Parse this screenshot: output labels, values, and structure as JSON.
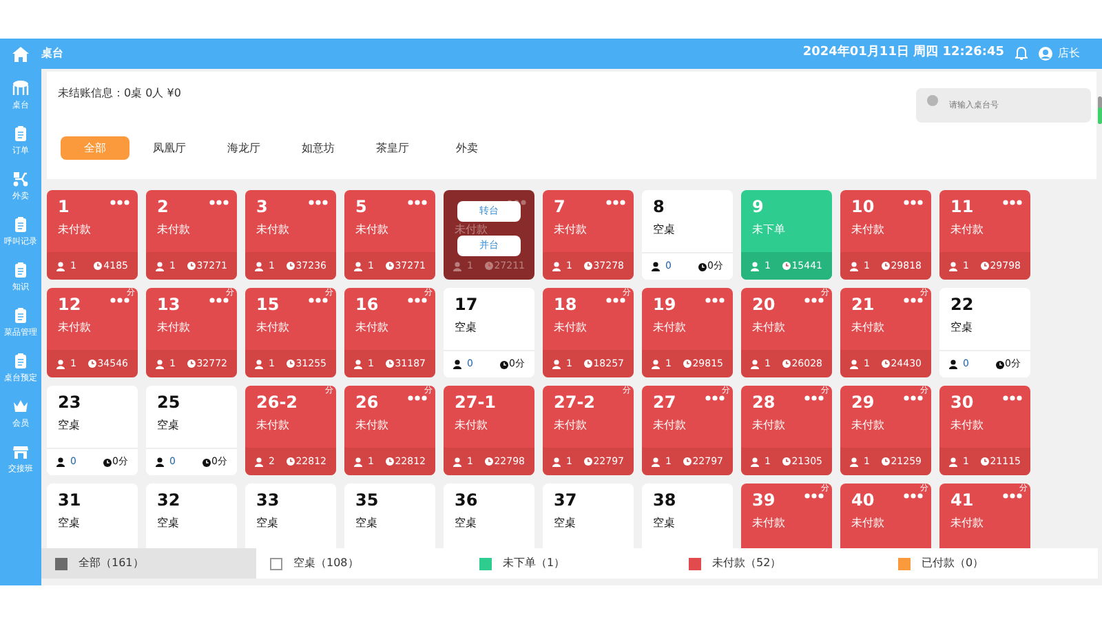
{
  "header": {
    "title": "桌台",
    "datetime": "2024年01月11日 周四 12:26:45",
    "user": "店长"
  },
  "sidebar": {
    "items": [
      {
        "label": "桌台"
      },
      {
        "label": "订单"
      },
      {
        "label": "外卖"
      },
      {
        "label": "呼叫记录"
      },
      {
        "label": "知识"
      },
      {
        "label": "菜品管理"
      },
      {
        "label": "桌台预定"
      },
      {
        "label": "会员"
      },
      {
        "label": "交接班"
      }
    ]
  },
  "summary": "未结账信息：0桌 0人 ¥0",
  "search": {
    "placeholder": "请输入桌台号"
  },
  "tabs": [
    {
      "label": "全部",
      "selected": true
    },
    {
      "label": "凤凰厅",
      "selected": false
    },
    {
      "label": "海龙厅",
      "selected": false
    },
    {
      "label": "如意坊",
      "selected": false
    },
    {
      "label": "茶皇厅",
      "selected": false
    },
    {
      "label": "外卖",
      "selected": false
    }
  ],
  "tables": [
    {
      "number": "1",
      "status": "未付款",
      "kind": "unpaid",
      "people": "1",
      "time": "4185",
      "dots": true
    },
    {
      "number": "2",
      "status": "未付款",
      "kind": "unpaid",
      "people": "1",
      "time": "37271",
      "dots": true
    },
    {
      "number": "3",
      "status": "未付款",
      "kind": "unpaid",
      "people": "1",
      "time": "37236",
      "dots": true
    },
    {
      "number": "5",
      "status": "未付款",
      "kind": "unpaid",
      "people": "1",
      "time": "37271",
      "dots": true
    },
    {
      "status": "未付款",
      "kind": "unpaid",
      "people": "1",
      "time": "27211",
      "dots": true,
      "menu": [
        "转台",
        "并台"
      ]
    },
    {
      "number": "7",
      "status": "未付款",
      "kind": "unpaid",
      "people": "1",
      "time": "37278",
      "dots": true
    },
    {
      "number": "8",
      "status": "空桌",
      "kind": "empty",
      "people": "0",
      "time": "0分",
      "dots": false
    },
    {
      "number": "9",
      "status": "未下单",
      "kind": "unordered",
      "people": "1",
      "time": "15441",
      "dots": false
    },
    {
      "number": "10",
      "status": "未付款",
      "kind": "unpaid",
      "people": "1",
      "time": "29818",
      "dots": true
    },
    {
      "number": "11",
      "status": "未付款",
      "kind": "unpaid",
      "people": "1",
      "time": "29798",
      "dots": true
    },
    {
      "number": "12",
      "status": "未付款",
      "kind": "unpaid",
      "people": "1",
      "time": "34546",
      "dots": true,
      "split": "分"
    },
    {
      "number": "13",
      "status": "未付款",
      "kind": "unpaid",
      "people": "1",
      "time": "32772",
      "dots": true,
      "split": "分"
    },
    {
      "number": "15",
      "status": "未付款",
      "kind": "unpaid",
      "people": "1",
      "time": "31255",
      "dots": true,
      "split": "分"
    },
    {
      "number": "16",
      "status": "未付款",
      "kind": "unpaid",
      "people": "1",
      "time": "31187",
      "dots": true,
      "split": "分"
    },
    {
      "number": "17",
      "status": "空桌",
      "kind": "empty",
      "people": "0",
      "time": "0分",
      "dots": false
    },
    {
      "number": "18",
      "status": "未付款",
      "kind": "unpaid",
      "people": "1",
      "time": "18257",
      "dots": true,
      "split": "分"
    },
    {
      "number": "19",
      "status": "未付款",
      "kind": "unpaid",
      "people": "1",
      "time": "29815",
      "dots": true
    },
    {
      "number": "20",
      "status": "未付款",
      "kind": "unpaid",
      "people": "1",
      "time": "26028",
      "dots": true,
      "split": "分"
    },
    {
      "number": "21",
      "status": "未付款",
      "kind": "unpaid",
      "people": "1",
      "time": "24430",
      "dots": true,
      "split": "分"
    },
    {
      "number": "22",
      "status": "空桌",
      "kind": "empty",
      "people": "0",
      "time": "0分",
      "dots": false
    },
    {
      "number": "23",
      "status": "空桌",
      "kind": "empty",
      "people": "0",
      "time": "0分",
      "dots": false
    },
    {
      "number": "25",
      "status": "空桌",
      "kind": "empty",
      "people": "0",
      "time": "0分",
      "dots": false
    },
    {
      "number": "26-2",
      "status": "未付款",
      "kind": "unpaid",
      "people": "2",
      "time": "22812",
      "dots": false,
      "split": "分"
    },
    {
      "number": "26",
      "status": "未付款",
      "kind": "unpaid",
      "people": "1",
      "time": "22812",
      "dots": true,
      "split": "分"
    },
    {
      "number": "27-1",
      "status": "未付款",
      "kind": "unpaid",
      "people": "1",
      "time": "22798",
      "dots": false
    },
    {
      "number": "27-2",
      "status": "未付款",
      "kind": "unpaid",
      "people": "1",
      "time": "22797",
      "dots": false,
      "split": "分"
    },
    {
      "number": "27",
      "status": "未付款",
      "kind": "unpaid",
      "people": "1",
      "time": "22797",
      "dots": true,
      "split": "分"
    },
    {
      "number": "28",
      "status": "未付款",
      "kind": "unpaid",
      "people": "1",
      "time": "21305",
      "dots": true,
      "split": "分"
    },
    {
      "number": "29",
      "status": "未付款",
      "kind": "unpaid",
      "people": "1",
      "time": "21259",
      "dots": true,
      "split": "分"
    },
    {
      "number": "30",
      "status": "未付款",
      "kind": "unpaid",
      "people": "1",
      "time": "21115",
      "dots": true
    },
    {
      "number": "31",
      "status": "空桌",
      "kind": "empty",
      "dots": false
    },
    {
      "number": "32",
      "status": "空桌",
      "kind": "empty",
      "dots": false
    },
    {
      "number": "33",
      "status": "空桌",
      "kind": "empty",
      "dots": false
    },
    {
      "number": "35",
      "status": "空桌",
      "kind": "empty",
      "dots": false
    },
    {
      "number": "36",
      "status": "空桌",
      "kind": "empty",
      "dots": false
    },
    {
      "number": "37",
      "status": "空桌",
      "kind": "empty",
      "dots": false
    },
    {
      "number": "38",
      "status": "空桌",
      "kind": "empty",
      "dots": false
    },
    {
      "number": "39",
      "status": "未付款",
      "kind": "unpaid",
      "dots": true,
      "split": "分"
    },
    {
      "number": "40",
      "status": "未付款",
      "kind": "unpaid",
      "dots": true,
      "split": "分"
    },
    {
      "number": "41",
      "status": "未付款",
      "kind": "unpaid",
      "dots": true,
      "split": "分"
    }
  ],
  "legend": [
    {
      "label": "全部（161）",
      "color": "#6b6b6b",
      "selected": true
    },
    {
      "label": "空桌（108）",
      "color": "#ffffff",
      "selected": false
    },
    {
      "label": "未下单（1）",
      "color": "#2ecc8f",
      "selected": false
    },
    {
      "label": "未付款（52）",
      "color": "#e24b4e",
      "selected": false
    },
    {
      "label": "已付款（0）",
      "color": "#fb9a3c",
      "selected": false
    }
  ]
}
